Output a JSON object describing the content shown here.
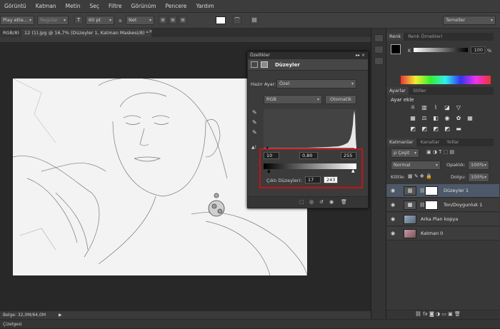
{
  "menu": [
    "Görüntü",
    "Katman",
    "Metin",
    "Seç",
    "Filtre",
    "Görünüm",
    "Pencere",
    "Yardım"
  ],
  "options": {
    "font_family": "Play ette...",
    "font_style": "Regular",
    "font_size": "60 pt",
    "aa_label": "a",
    "aa_value": "Net",
    "workspace": "Temeller"
  },
  "tabs": {
    "partial": "RGB/8)",
    "active": "12 (1).jpg @ 16,7% (Düzeyler 1, Katman Maskesi/8) *"
  },
  "status": {
    "doc_size": "Belge: 32,0M/64,0M"
  },
  "bottom_label": "Çizelgesi",
  "properties": {
    "title": "Özellikler",
    "adjustment_name": "Düzeyler",
    "preset_label": "Hazır Ayar:",
    "preset_value": "Özel",
    "channel": "RGB",
    "auto_button": "Otomatik",
    "input_black": "10",
    "input_gamma": "0,80",
    "input_white": "255",
    "output_label": "Çıktı Düzeyleri:",
    "output_black": "17",
    "output_white": "243"
  },
  "color_panel": {
    "tab_color": "Renk",
    "tab_swatches": "Renk Örnekleri",
    "channel_label": "K",
    "channel_value": "100",
    "percent": "%"
  },
  "adjustments_panel": {
    "tab_adjust": "Ayarlar",
    "tab_styles": "Stiller",
    "add_label": "Ayar ekle"
  },
  "layers_panel": {
    "tab_layers": "Katmanlar",
    "tab_channels": "Kanallar",
    "tab_paths": "Yollar",
    "filter_label": "ρ Çeşit",
    "blend_mode": "Normal",
    "opacity_label": "Opaklık:",
    "opacity_value": "100%",
    "lock_label": "Kilitle:",
    "fill_label": "Dolgu:",
    "fill_value": "100%",
    "layers": [
      {
        "name": "Düzeyler 1",
        "selected": true
      },
      {
        "name": "Ton/Doygunluk 1",
        "selected": false
      },
      {
        "name": "Arka Plan kopya",
        "selected": false
      },
      {
        "name": "Katman 0",
        "selected": false
      }
    ]
  },
  "colors": {
    "highlight_box": "#c0151a",
    "layer_selected": "#4d5868"
  }
}
